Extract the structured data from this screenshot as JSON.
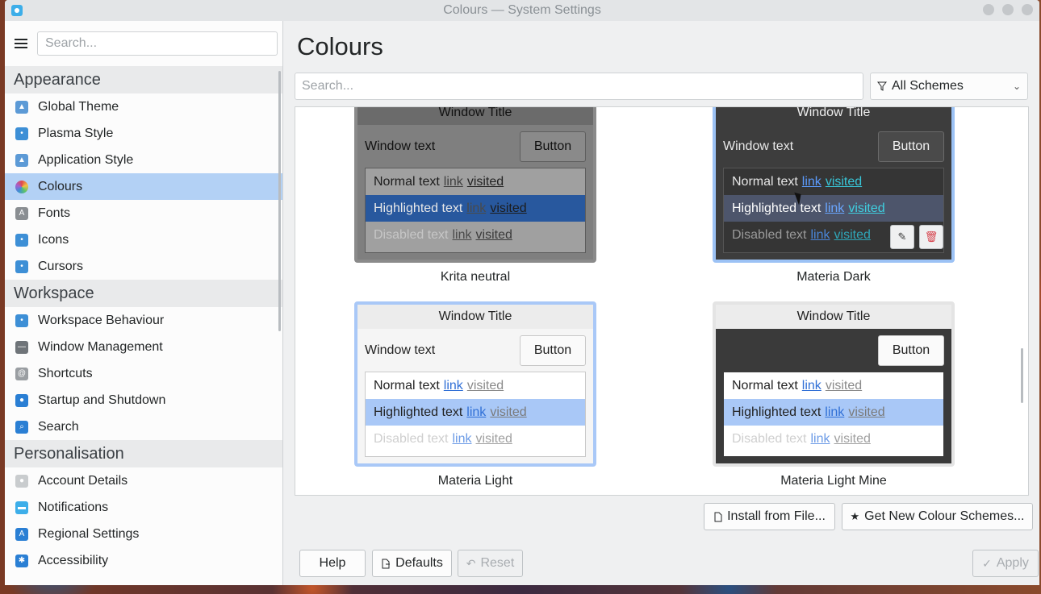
{
  "window": {
    "title": "Colours — System Settings"
  },
  "sidebar": {
    "search_placeholder": "Search...",
    "sections": [
      {
        "title": "Appearance",
        "items": [
          {
            "label": "Global Theme",
            "icon": "global-theme-icon",
            "color": "#5c9ad6"
          },
          {
            "label": "Plasma Style",
            "icon": "plasma-style-icon",
            "color": "#3d8fd6"
          },
          {
            "label": "Application Style",
            "icon": "application-style-icon",
            "color": "#5c9ad6"
          },
          {
            "label": "Colours",
            "icon": "colours-icon",
            "color": "#e0484c",
            "active": true
          },
          {
            "label": "Fonts",
            "icon": "fonts-icon",
            "color": "#8a8e92"
          },
          {
            "label": "Icons",
            "icon": "icons-icon",
            "color": "#3d8fd6"
          },
          {
            "label": "Cursors",
            "icon": "cursors-icon",
            "color": "#3d8fd6"
          }
        ]
      },
      {
        "title": "Workspace",
        "items": [
          {
            "label": "Workspace Behaviour",
            "icon": "workspace-behaviour-icon",
            "color": "#3d8fd6"
          },
          {
            "label": "Window Management",
            "icon": "window-management-icon",
            "color": "#6f7479"
          },
          {
            "label": "Shortcuts",
            "icon": "shortcuts-icon",
            "color": "#9a9ea2"
          },
          {
            "label": "Startup and Shutdown",
            "icon": "startup-shutdown-icon",
            "color": "#2a7fd4"
          },
          {
            "label": "Search",
            "icon": "search-icon",
            "color": "#2a7fd4"
          }
        ]
      },
      {
        "title": "Personalisation",
        "items": [
          {
            "label": "Account Details",
            "icon": "account-details-icon",
            "color": "#c9ccce"
          },
          {
            "label": "Notifications",
            "icon": "notifications-icon",
            "color": "#3daee9"
          },
          {
            "label": "Regional Settings",
            "icon": "regional-settings-icon",
            "color": "#2a7fd4"
          },
          {
            "label": "Accessibility",
            "icon": "accessibility-icon",
            "color": "#2a7fd4"
          }
        ]
      }
    ]
  },
  "main": {
    "title": "Colours",
    "search_placeholder": "Search...",
    "filter": "All Schemes",
    "schemes": [
      {
        "name": "Krita neutral",
        "window_title": "Window Title",
        "window_text": "Window text",
        "button": "Button",
        "normal": "Normal text",
        "highlighted": "Highlighted text",
        "disabled": "Disabled text",
        "link": "link",
        "visited": "visited",
        "colors": {
          "title_bg": "#6b6b6b",
          "title_fg": "#111111",
          "win_bg": "#7f7f7f",
          "win_fg": "#111111",
          "btn_bg": "#8a8a8a",
          "btn_fg": "#111111",
          "btn_border": "#5e5e5e",
          "view_bg": "#a0a0a0",
          "view_fg": "#1c1c1c",
          "hl_bg": "#28589e",
          "hl_fg": "#e8e8e8",
          "dis_fg": "#c6c6c6",
          "link": "#3f3f3f",
          "visited": "#222222",
          "hl_link": "#4a4a4a",
          "hl_visited": "#1c1c1c",
          "dis_link": "#4b4b4b",
          "dis_visited": "#3a3a3a",
          "frame": "#8a8a8a",
          "list_border": "#5c5c5c"
        }
      },
      {
        "name": "Materia Dark",
        "window_title": "Window Title",
        "window_text": "Window text",
        "button": "Button",
        "normal": "Normal text",
        "highlighted": "Highlighted text",
        "disabled": "Disabled text",
        "link": "link",
        "visited": "visited",
        "colors": {
          "title_bg": "#3d3d3d",
          "title_fg": "#eeeeee",
          "win_bg": "#3d3d3d",
          "win_fg": "#e8e8e8",
          "btn_bg": "#4a4a4a",
          "btn_fg": "#f0f0f0",
          "btn_border": "#6a6a6a",
          "view_bg": "#353535",
          "view_fg": "#e6e6e6",
          "hl_bg": "#4d556b",
          "hl_fg": "#ffffff",
          "dis_fg": "#9a9a9a",
          "link": "#5c9cff",
          "visited": "#38c6d8",
          "hl_link": "#6aa6ff",
          "hl_visited": "#3fcfe0",
          "dis_link": "#4a86d8",
          "dis_visited": "#2fa6b8",
          "frame": "#9cc2f5",
          "list_border": "#555555"
        }
      },
      {
        "name": "Materia Light",
        "window_title": "Window Title",
        "window_text": "Window text",
        "button": "Button",
        "normal": "Normal text",
        "highlighted": "Highlighted text",
        "disabled": "Disabled text",
        "link": "link",
        "visited": "visited",
        "colors": {
          "title_bg": "#ececec",
          "title_fg": "#222222",
          "win_bg": "#f5f5f5",
          "win_fg": "#222222",
          "btn_bg": "#fafafa",
          "btn_fg": "#222222",
          "btn_border": "#c9c9c9",
          "view_bg": "#ffffff",
          "view_fg": "#222222",
          "hl_bg": "#a9c8f7",
          "hl_fg": "#222222",
          "dis_fg": "#cfcfcf",
          "link": "#2f6fd6",
          "visited": "#8a8a8a",
          "hl_link": "#2f6fd6",
          "hl_visited": "#7a7a7a",
          "dis_link": "#6c9be6",
          "dis_visited": "#a0a0a0",
          "frame": "#a9c8f7",
          "list_border": "#c9c9c9"
        }
      },
      {
        "name": "Materia Light Mine",
        "window_title": "Window Title",
        "window_text": "",
        "button": "Button",
        "normal": "Normal text",
        "highlighted": "Highlighted text",
        "disabled": "Disabled text",
        "link": "link",
        "visited": "visited",
        "colors": {
          "title_bg": "#ececec",
          "title_fg": "#222222",
          "win_bg": "#3a3a3a",
          "win_fg": "#eeeeee",
          "btn_bg": "#fafafa",
          "btn_fg": "#222222",
          "btn_border": "#c9c9c9",
          "view_bg": "#ffffff",
          "view_fg": "#222222",
          "hl_bg": "#a9c8f7",
          "hl_fg": "#222222",
          "dis_fg": "#cfcfcf",
          "link": "#2f6fd6",
          "visited": "#8a8a8a",
          "hl_link": "#2f6fd6",
          "hl_visited": "#7a7a7a",
          "dis_link": "#6c9be6",
          "dis_visited": "#a0a0a0",
          "frame": "#e4e4e4",
          "list_border": "#3a3a3a"
        }
      }
    ],
    "install_label": "Install from File...",
    "get_new_label": "Get New Colour Schemes...",
    "help_label": "Help",
    "defaults_label": "Defaults",
    "reset_label": "Reset",
    "apply_label": "Apply"
  }
}
